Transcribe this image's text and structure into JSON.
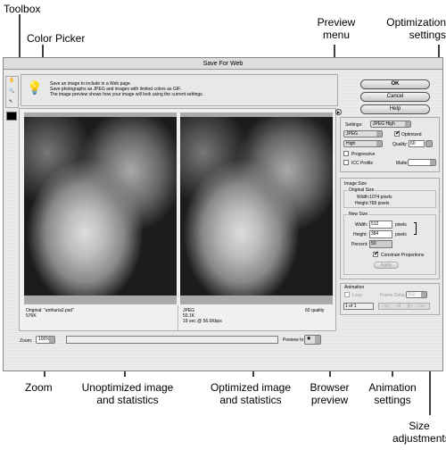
{
  "callouts": {
    "toolbox": "Toolbox",
    "color_picker": "Color Picker",
    "preview_menu": "Preview menu",
    "optimization_settings": "Optimization settings",
    "zoom": "Zoom",
    "unoptimized": "Unoptimized image and statistics",
    "optimized": "Optimized image and statistics",
    "browser_preview": "Browser preview",
    "animation_settings": "Animation settings",
    "size_adjustments": "Size adjustments"
  },
  "dialog": {
    "title": "Save For Web",
    "info": [
      "Save an image to include in a Web page.",
      "Save photographs as JPEG and images with limited colors as GIF.",
      "The image preview shows how your image will look using the current settings."
    ],
    "buttons": {
      "ok": "OK",
      "cancel": "Cancel",
      "help": "Help"
    },
    "settings": {
      "label": "Settings:",
      "preset": "JPEG High",
      "format": "JPEG",
      "quality_level": "High",
      "optimized": "Optimized",
      "optimized_checked": true,
      "quality_label": "Quality:",
      "quality": "60",
      "progressive": "Progressive",
      "icc_profile": "ICC Profile",
      "matte_label": "Matte:",
      "matte": ""
    },
    "image_size": {
      "title": "Image Size",
      "original_title": "Original Size",
      "orig_width": "Width:1074 pixels",
      "orig_height": "Height:768 pixels",
      "new_title": "New Size",
      "width_label": "Width:",
      "width": "512",
      "height_label": "Height:",
      "height": "384",
      "unit": "pixels",
      "percent_label": "Percent:",
      "percent": "50",
      "constrain": "Constrain Proportions",
      "constrain_checked": true,
      "apply": "Apply"
    },
    "animation": {
      "title": "Animation",
      "loop": "Loop",
      "frame_delay_label": "Frame Delay:",
      "frame_delay": "0.2",
      "frame": "1 of 1",
      "controls": [
        "first-frame",
        "prev-frame",
        "next-frame",
        "last-frame"
      ]
    },
    "original": {
      "name": "Original: \"anthuria2.psd\"",
      "size": "576K"
    },
    "optimized_stats": {
      "format": "JPEG",
      "size": "59.1K",
      "time": "19 sec @ 56.6Kbps",
      "quality": "60 quality"
    },
    "zoom": {
      "label": "Zoom:",
      "value": "100%"
    },
    "preview_in": {
      "label": "Preview In:"
    },
    "foreground_color": "#000000"
  }
}
